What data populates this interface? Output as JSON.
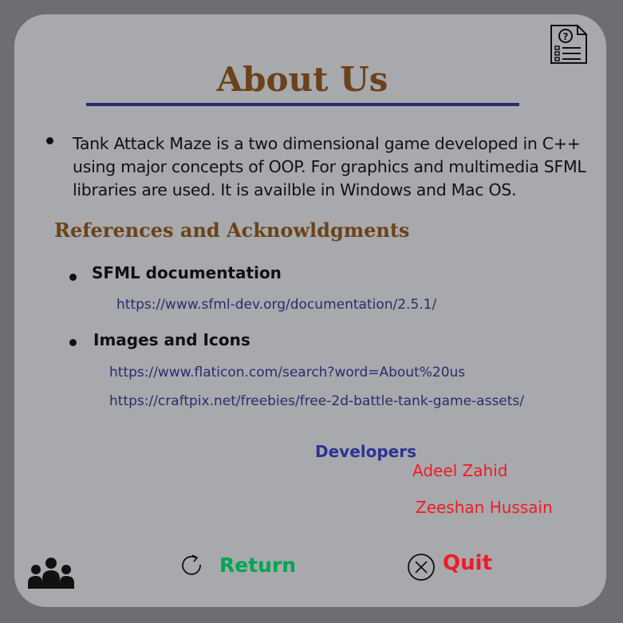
{
  "header": {
    "title": "About Us",
    "help_icon": "help-document-icon"
  },
  "intro": {
    "text": "Tank Attack Maze is a two dimensional game developed in C++ using major concepts of OOP. For graphics and multimedia SFML libraries are used. It is availble in Windows and Mac OS."
  },
  "references": {
    "heading": "References and Acknowldgments",
    "items": [
      {
        "label": "SFML documentation",
        "links": [
          "https://www.sfml-dev.org/documentation/2.5.1/"
        ]
      },
      {
        "label": "Images and Icons",
        "links": [
          "https://www.flaticon.com/search?word=About%20us",
          "https://craftpix.net/freebies/free-2d-battle-tank-game-assets/"
        ]
      }
    ]
  },
  "developers": {
    "heading": "Developers",
    "names": [
      "Adeel Zahid",
      "Zeeshan Hussain"
    ]
  },
  "footer": {
    "team_icon": "people-icon",
    "return_label": "Return",
    "return_icon": "refresh-icon",
    "quit_label": "Quit",
    "quit_icon": "close-circle-icon"
  },
  "colors": {
    "background": "#6d6e71",
    "panel": "#a7a9ac",
    "title": "#6b4219",
    "rule": "#2e2a6e",
    "link": "#2e2a6e",
    "developers_heading": "#2e3192",
    "developer_names": "#ed1c24",
    "return": "#00a651",
    "quit": "#ed1c24"
  }
}
